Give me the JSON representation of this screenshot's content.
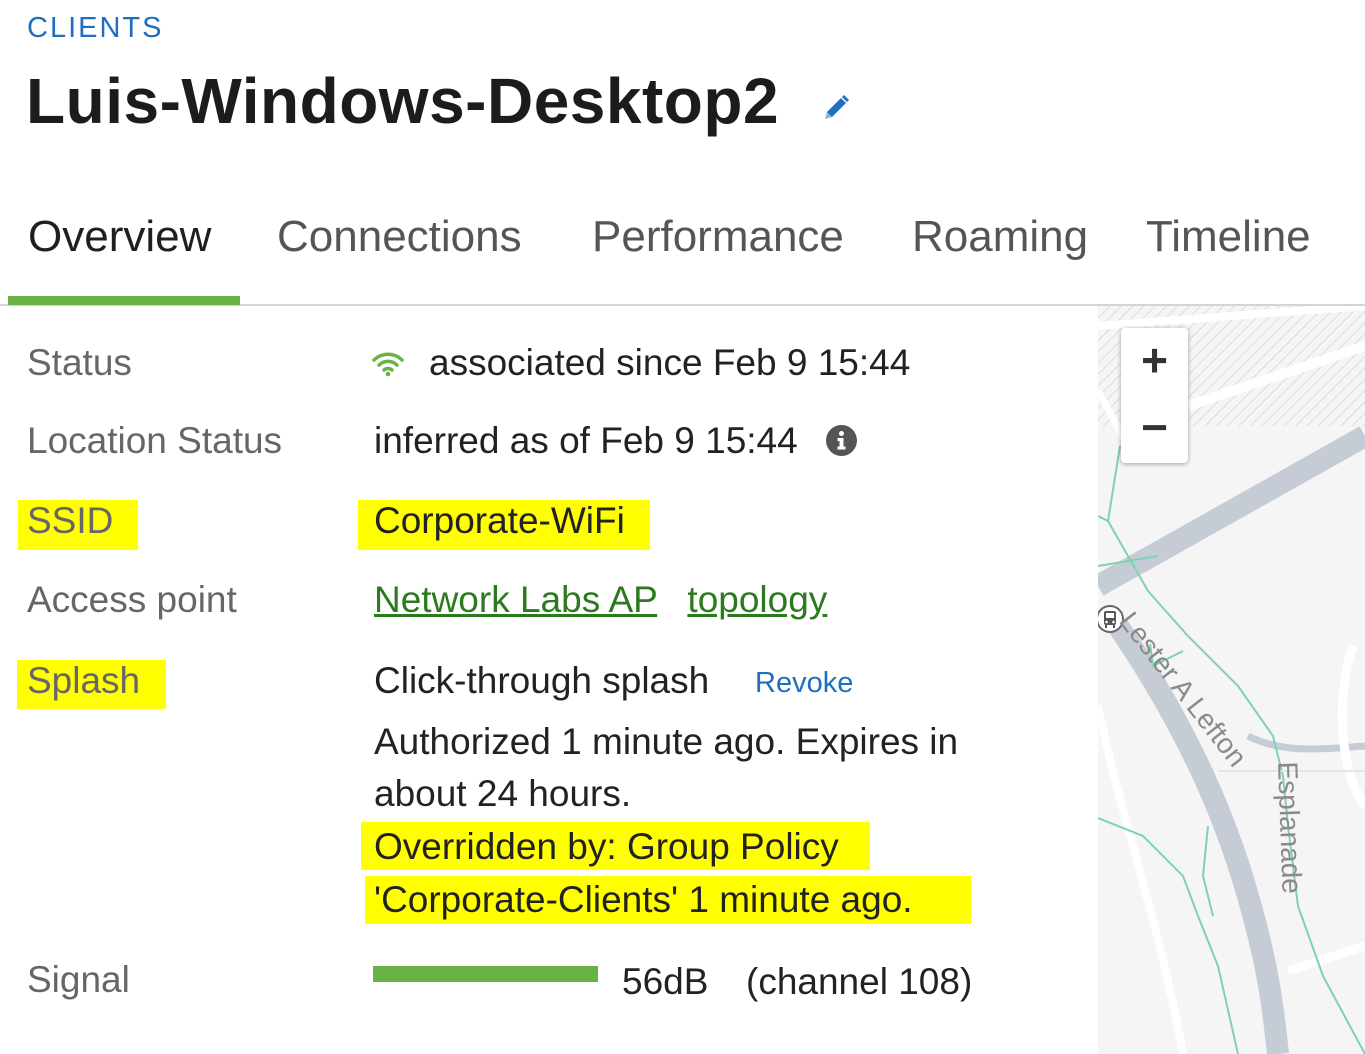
{
  "breadcrumb": "CLIENTS",
  "title": "Luis-Windows-Desktop2",
  "tabs": [
    "Overview",
    "Connections",
    "Performance",
    "Roaming",
    "Timeline"
  ],
  "active_tab": "Overview",
  "details": {
    "status": {
      "label": "Status",
      "value": "associated since Feb 9 15:44",
      "icon": "wifi-icon"
    },
    "location_status": {
      "label": "Location Status",
      "value": "inferred as of Feb 9 15:44",
      "icon": "info-icon"
    },
    "ssid": {
      "label": "SSID",
      "value": "Corporate-WiFi"
    },
    "access_point": {
      "label": "Access point",
      "ap_link": "Network Labs AP",
      "topology_link": "topology"
    },
    "splash": {
      "label": "Splash",
      "value": "Click-through splash",
      "revoke": "Revoke",
      "line1": "Authorized 1 minute ago.  Expires in",
      "line2": "about 24 hours.",
      "line3": "Overridden by: Group Policy",
      "line4": "'Corporate-Clients' 1 minute ago."
    },
    "signal": {
      "label": "Signal",
      "value": "56dB",
      "channel": "(channel 108)"
    }
  },
  "map": {
    "zoom_in": "+",
    "zoom_out": "−",
    "street_1": "Lester A Lefton",
    "street_2": "Esplanade",
    "transit_icon": "bus-icon"
  },
  "colors": {
    "accent_green": "#6ab245",
    "link_blue": "#1f6fbf",
    "link_green": "#2b7a1d",
    "highlight": "#ffff00"
  }
}
